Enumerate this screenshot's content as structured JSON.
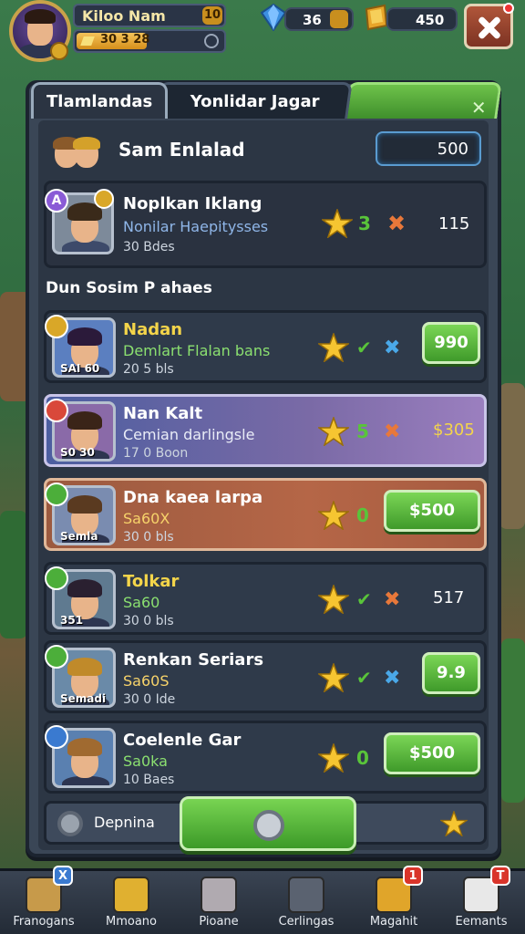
{
  "player": {
    "name": "Kiloo Nam",
    "level": "10",
    "xp_text": "30 3 28",
    "xp_progress": 0.55
  },
  "resources": {
    "gems": "36",
    "gold": "450"
  },
  "tabs": {
    "active": "Tlamlandas",
    "inactive": "Yonlidar Jagar",
    "close_glyph": "✕"
  },
  "summary": {
    "title": "Sam Enlalad",
    "value": "500"
  },
  "featured": {
    "name": "Noplkan Iklang",
    "sub": "Nonilar Haepitysses",
    "meta": "30 Bdes",
    "badge_left": "A",
    "price": "115",
    "check": "3",
    "accent": "#8a5bd6"
  },
  "section_title": "Dun Sosim P ahaes",
  "rows": [
    {
      "name": "Nadan",
      "sub": "Demlart Flalan bans",
      "meta": "20 5 bls",
      "tag": "SAI 60",
      "mark_a": "✔",
      "mark_b": "✖",
      "action": "990",
      "action_type": "button",
      "sub_color": "#8be070",
      "name_color": "#f4d54a"
    },
    {
      "name": "Nan Kalt",
      "sub": "Cemian darlingsle",
      "meta": "17 0 Boon",
      "tag": "S0 30",
      "mark_a": "5",
      "mark_b": "✖",
      "action": "$305",
      "action_type": "price",
      "sub_color": "#e9ecf7",
      "name_color": "#ffffff"
    },
    {
      "name": "Dna kaea larpa",
      "sub": "Sa60X",
      "meta": "30 0 bls",
      "tag": "Semla",
      "mark_a": "0",
      "mark_b": "",
      "action": "$500",
      "action_type": "button",
      "sub_color": "#f7d36a",
      "name_color": "#ffffff"
    },
    {
      "name": "Tolkar",
      "sub": "Sa60",
      "meta": "30 0 bls",
      "tag": "351",
      "mark_a": "✔",
      "mark_b": "✖",
      "action": "517",
      "action_type": "price",
      "sub_color": "#8be070",
      "name_color": "#f4d54a"
    },
    {
      "name": "Renkan Seriars",
      "sub": "Sa60S",
      "meta": "30 0 Ide",
      "tag": "Semadi",
      "mark_a": "✔",
      "mark_b": "✖",
      "action": "9.9",
      "action_type": "button",
      "sub_color": "#f7d36a",
      "name_color": "#ffffff"
    },
    {
      "name": "Coelenle Gar",
      "sub": "Sa0ka",
      "meta": "10 Baes",
      "tag": "",
      "mark_a": "0",
      "mark_b": "",
      "action": "$500",
      "action_type": "button",
      "sub_color": "#8be070",
      "name_color": "#ffffff"
    }
  ],
  "bottom_strip": {
    "label": "Depnina"
  },
  "nav": [
    {
      "label": "Franogans",
      "icon": "crate-icon",
      "badge": "X"
    },
    {
      "label": "Mmoano",
      "icon": "puzzle-icon",
      "badge": ""
    },
    {
      "label": "Pioane",
      "icon": "gear-icon",
      "badge": ""
    },
    {
      "label": "Cerlingas",
      "icon": "chest-icon",
      "badge": ""
    },
    {
      "label": "Magahit",
      "icon": "gold-box-icon",
      "badge": "1"
    },
    {
      "label": "Eemants",
      "icon": "skull-icon",
      "badge": "T"
    }
  ]
}
